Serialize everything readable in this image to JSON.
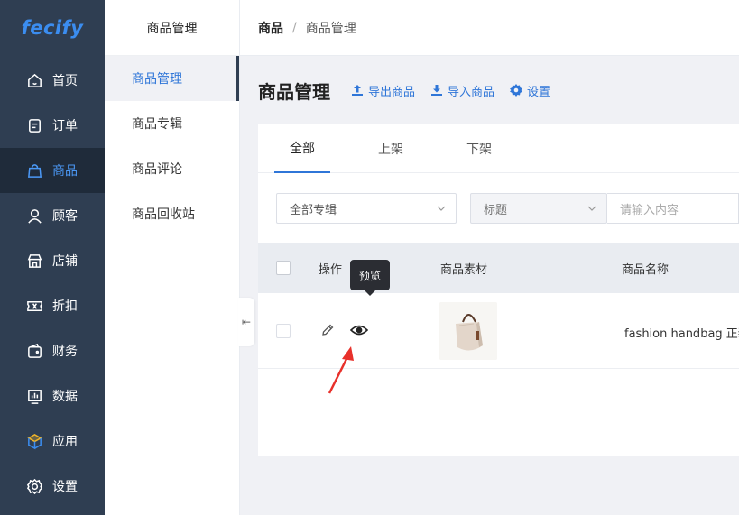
{
  "logo": {
    "text": "fecify"
  },
  "sidebar": {
    "items": [
      {
        "label": "首页",
        "icon": "home-icon"
      },
      {
        "label": "订单",
        "icon": "order-icon"
      },
      {
        "label": "商品",
        "icon": "bag-icon",
        "active": true
      },
      {
        "label": "顾客",
        "icon": "user-icon"
      },
      {
        "label": "店铺",
        "icon": "store-icon"
      },
      {
        "label": "折扣",
        "icon": "coupon-icon"
      },
      {
        "label": "财务",
        "icon": "wallet-icon"
      },
      {
        "label": "数据",
        "icon": "chart-icon"
      },
      {
        "label": "应用",
        "icon": "cube-icon"
      },
      {
        "label": "设置",
        "icon": "gear-icon"
      }
    ]
  },
  "subnav": {
    "title": "商品管理",
    "items": [
      {
        "label": "商品管理",
        "active": true
      },
      {
        "label": "商品专辑"
      },
      {
        "label": "商品评论"
      },
      {
        "label": "商品回收站"
      }
    ]
  },
  "breadcrumb": {
    "root": "商品",
    "sep": "/",
    "current": "商品管理"
  },
  "page": {
    "title": "商品管理",
    "export_label": "导出商品",
    "import_label": "导入商品",
    "settings_label": "设置"
  },
  "tabs": [
    {
      "label": "全部",
      "active": true
    },
    {
      "label": "上架"
    },
    {
      "label": "下架"
    }
  ],
  "filters": {
    "album_select": "全部专辑",
    "field_select": "标题",
    "search_placeholder": "请输入内容"
  },
  "table": {
    "headers": {
      "actions": "操作",
      "material": "商品素材",
      "name": "商品名称"
    },
    "rows": [
      {
        "name": "fashion handbag 正装"
      }
    ]
  },
  "tooltip": {
    "text": "预览"
  },
  "colors": {
    "sidebar": "#2f3e52",
    "accent": "#2f76d8",
    "annotation_arrow": "#e8312b"
  }
}
